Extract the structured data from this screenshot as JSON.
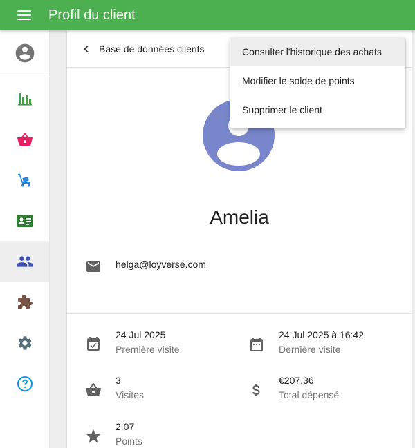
{
  "appbar": {
    "title": "Profil du client",
    "color": "#4caf50"
  },
  "sidebar": {
    "items": [
      {
        "icon": "account-circle-icon",
        "color": "#757575"
      },
      {
        "icon": "bar-chart-icon",
        "color": "#43a047"
      },
      {
        "icon": "basket-icon",
        "color": "#e91e63"
      },
      {
        "icon": "hand-truck-icon",
        "color": "#1e88e5"
      },
      {
        "icon": "id-card-icon",
        "color": "#2e7d32"
      },
      {
        "icon": "people-icon",
        "color": "#3f51b5",
        "active": true
      },
      {
        "icon": "puzzle-icon",
        "color": "#795548"
      },
      {
        "icon": "gear-icon",
        "color": "#546e7a"
      },
      {
        "icon": "help-circle-icon",
        "color": "#039be5"
      }
    ]
  },
  "header": {
    "back_label": "Base de données clients"
  },
  "dropdown": {
    "items": [
      "Consulter l'historique des achats",
      "Modifier le solde de points",
      "Supprimer le client"
    ]
  },
  "client": {
    "name": "Amelia",
    "avatar_color": "#7986cb",
    "email": "helga@loyverse.com"
  },
  "stats": {
    "first_visit": {
      "value": "24 Jul 2025",
      "label": "Première visite"
    },
    "last_visit": {
      "value": "24 Jul 2025 à  16:42",
      "label": "Dernière visite"
    },
    "visits": {
      "value": "3",
      "label": "Visites"
    },
    "total_spent": {
      "value": "€207.36",
      "label": "Total dépensé"
    },
    "points": {
      "value": "2.07",
      "label": "Points"
    }
  }
}
